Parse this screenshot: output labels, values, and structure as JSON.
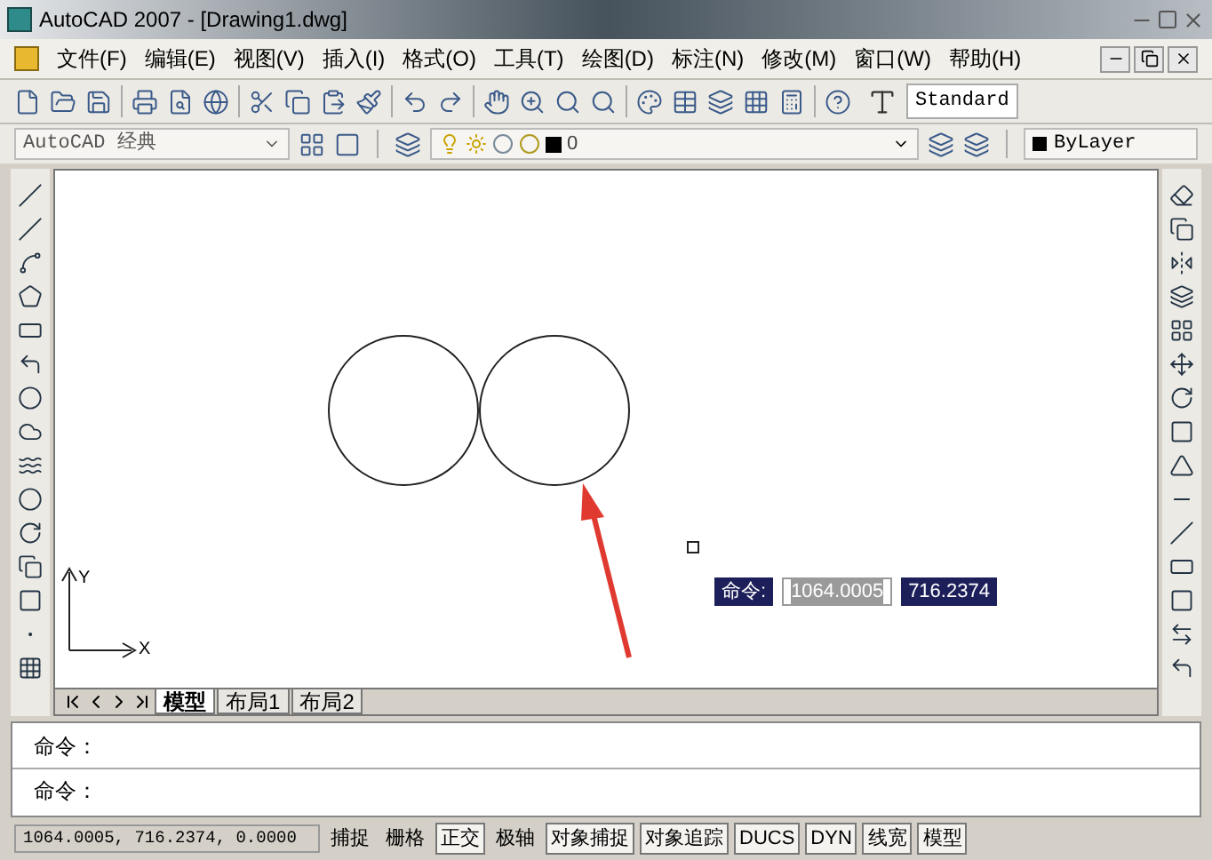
{
  "window": {
    "title": "AutoCAD 2007 - [Drawing1.dwg]"
  },
  "menu": [
    "文件(F)",
    "编辑(E)",
    "视图(V)",
    "插入(I)",
    "格式(O)",
    "工具(T)",
    "绘图(D)",
    "标注(N)",
    "修改(M)",
    "窗口(W)",
    "帮助(H)"
  ],
  "toolbar": {
    "text_style": "Standard"
  },
  "workspace": {
    "value": "AutoCAD 经典"
  },
  "layer": {
    "value": "0"
  },
  "color": {
    "value": "ByLayer"
  },
  "canvas": {
    "ucs": {
      "y_label": "Y",
      "x_label": "X"
    },
    "dynamic_input": {
      "label": "命令:",
      "x_value": "1064.0005",
      "y_value": "716.2374"
    }
  },
  "layout_tabs": [
    {
      "label": "模型",
      "selected": true
    },
    {
      "label": "布局1",
      "selected": false
    },
    {
      "label": "布局2",
      "selected": false
    }
  ],
  "command_lines": [
    "命令：",
    "命令："
  ],
  "status_bar": {
    "coordinates": "1064.0005, 716.2374, 0.0000",
    "toggles": [
      {
        "label": "捕捉",
        "on": false
      },
      {
        "label": "栅格",
        "on": false
      },
      {
        "label": "正交",
        "on": true
      },
      {
        "label": "极轴",
        "on": false
      },
      {
        "label": "对象捕捉",
        "on": true
      },
      {
        "label": "对象追踪",
        "on": true
      },
      {
        "label": "DUCS",
        "on": true
      },
      {
        "label": "DYN",
        "on": true
      },
      {
        "label": "线宽",
        "on": true
      },
      {
        "label": "模型",
        "on": true
      }
    ]
  }
}
